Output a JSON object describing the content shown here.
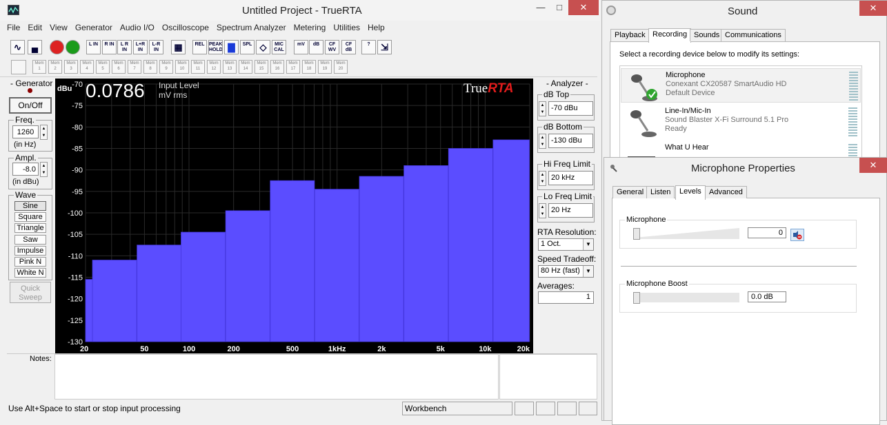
{
  "main_window": {
    "title": "Untitled Project - TrueRTA",
    "menu": [
      "File",
      "Edit",
      "View",
      "Generator",
      "Audio I/O",
      "Oscilloscope",
      "Spectrum Analyzer",
      "Metering",
      "Utilities",
      "Help"
    ],
    "toolbar": [
      {
        "label": "",
        "icon": "sine-wave-icon"
      },
      {
        "label": "",
        "icon": "spectrum-icon"
      },
      {
        "label": "STOP",
        "icon": "stop-icon"
      },
      {
        "label": "GO",
        "icon": "go-icon"
      },
      {
        "label": "L IN"
      },
      {
        "label": "R IN"
      },
      {
        "label": "L R IN"
      },
      {
        "label": "L+R IN"
      },
      {
        "label": "L-R IN"
      },
      {
        "label": "",
        "icon": "grid-icon"
      },
      {
        "label": "REL"
      },
      {
        "label": "PEAK HOLD"
      },
      {
        "label": "",
        "icon": "bars-icon"
      },
      {
        "label": "SPL"
      },
      {
        "label": "",
        "icon": "cal-icon"
      },
      {
        "label": "MIC CAL"
      },
      {
        "label": "mV"
      },
      {
        "label": "dB"
      },
      {
        "label": "CF WV"
      },
      {
        "label": "CF dB"
      },
      {
        "label": "?"
      },
      {
        "label": "",
        "icon": "help-arrow-icon"
      }
    ],
    "memory_buttons": [
      "Mem 1",
      "Mem 2",
      "Mem 3",
      "Mem 4",
      "Mem 5",
      "Mem 6",
      "Mem 7",
      "Mem 8",
      "Mem 9",
      "Mem 10",
      "Mem 11",
      "Mem 12",
      "Mem 13",
      "Mem 14",
      "Mem 15",
      "Mem 16",
      "Mem 17",
      "Mem 18",
      "Mem 19",
      "Mem 20"
    ],
    "generator": {
      "title": "- Generator -",
      "onoff_label": "On/Off",
      "freq_label": "Freq.",
      "freq_value": "1260",
      "freq_unit": "(in Hz)",
      "ampl_label": "Ampl.",
      "ampl_value": "-8.0",
      "ampl_unit": "(in dBu)",
      "wave_label": "Wave",
      "waves": [
        "Sine",
        "Square",
        "Triangle",
        "Saw",
        "Impulse",
        "Pink N",
        "White N"
      ],
      "quick_sweep_label": "Quick Sweep"
    },
    "readout": {
      "value": "0.0786",
      "label": "Input Level",
      "unit": "mV rms",
      "brand_true": "True",
      "brand_rta": "RTA"
    },
    "analyzer": {
      "title": "- Analyzer -",
      "db_top_label": "dB Top",
      "db_top_value": "-70 dBu",
      "db_bottom_label": "dB Bottom",
      "db_bottom_value": "-130 dBu",
      "hi_freq_label": "Hi Freq Limit",
      "hi_freq_value": "20 kHz",
      "lo_freq_label": "Lo Freq Limit",
      "lo_freq_value": "20 Hz",
      "rta_res_label": "RTA Resolution:",
      "rta_res_value": "1 Oct.",
      "speed_label": "Speed Tradeoff:",
      "speed_value": "80 Hz (fast)",
      "averages_label": "Averages:",
      "averages_value": "1"
    },
    "notes_label": "Notes:",
    "status_text": "Use Alt+Space to start or stop input processing",
    "status_mode": "Workbench"
  },
  "chart_data": {
    "type": "bar",
    "ylabel": "dBu",
    "ylim": [
      -130,
      -70
    ],
    "yticks": [
      -70,
      -75,
      -80,
      -85,
      -90,
      -95,
      -100,
      -105,
      -110,
      -115,
      -120,
      -125,
      -130
    ],
    "xscale": "log",
    "xlim": [
      20,
      20000
    ],
    "xtick_labels": [
      "20",
      "50",
      "100",
      "200",
      "500",
      "1kHz",
      "2k",
      "5k",
      "10k",
      "20k"
    ],
    "xtick_values": [
      20,
      50,
      100,
      200,
      500,
      1000,
      2000,
      5000,
      10000,
      20000
    ],
    "bands": [
      {
        "center": 20,
        "value": -115.5
      },
      {
        "center": 31.5,
        "value": -111
      },
      {
        "center": 63,
        "value": -107.5
      },
      {
        "center": 125,
        "value": -104.5
      },
      {
        "center": 250,
        "value": -99.5
      },
      {
        "center": 500,
        "value": -92.5
      },
      {
        "center": 1000,
        "value": -94.5
      },
      {
        "center": 2000,
        "value": -91.5
      },
      {
        "center": 4000,
        "value": -89
      },
      {
        "center": 8000,
        "value": -85
      },
      {
        "center": 16000,
        "value": -83
      }
    ],
    "bar_color": "#5b4dff",
    "grid": true
  },
  "sound_dialog": {
    "title": "Sound",
    "tabs": [
      "Playback",
      "Recording",
      "Sounds",
      "Communications"
    ],
    "active_tab": "Recording",
    "instruction": "Select a recording device below to modify its settings:",
    "devices": [
      {
        "name": "Microphone",
        "desc": "Conexant CX20587 SmartAudio HD",
        "status": "Default Device"
      },
      {
        "name": "Line-In/Mic-In",
        "desc": "Sound Blaster X-Fi Surround 5.1 Pro",
        "status": "Ready"
      },
      {
        "name": "What U Hear",
        "desc": "",
        "status": ""
      }
    ]
  },
  "mic_props": {
    "title": "Microphone Properties",
    "tabs": [
      "General",
      "Listen",
      "Levels",
      "Advanced"
    ],
    "active_tab": "Levels",
    "mic_label": "Microphone",
    "mic_value": "0",
    "boost_label": "Microphone Boost",
    "boost_value": "0.0 dB"
  }
}
